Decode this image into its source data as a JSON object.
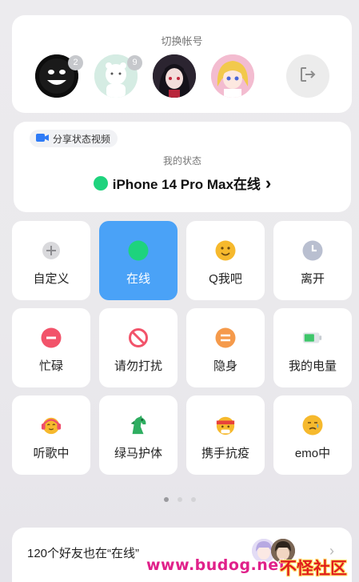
{
  "account_switch": {
    "title": "切换帐号",
    "accounts": [
      {
        "badge": "2"
      },
      {
        "badge": "9"
      },
      {
        "badge": ""
      },
      {
        "badge": ""
      }
    ]
  },
  "status_card": {
    "share_label": "分享状态视频",
    "my_status_label": "我的状态",
    "current_status": "iPhone 14 Pro Max在线",
    "chevron": "›"
  },
  "status_options": [
    {
      "label": "自定义",
      "icon": "plus-icon"
    },
    {
      "label": "在线",
      "icon": "online-dot-icon",
      "selected": true
    },
    {
      "label": "Q我吧",
      "icon": "smile-icon"
    },
    {
      "label": "离开",
      "icon": "clock-icon"
    },
    {
      "label": "忙碌",
      "icon": "minus-icon"
    },
    {
      "label": "请勿打扰",
      "icon": "no-entry-icon"
    },
    {
      "label": "隐身",
      "icon": "equals-icon"
    },
    {
      "label": "我的电量",
      "icon": "battery-icon"
    },
    {
      "label": "听歌中",
      "icon": "headphones-face-icon"
    },
    {
      "label": "绿马护体",
      "icon": "green-horse-icon"
    },
    {
      "label": "携手抗疫",
      "icon": "headband-face-icon"
    },
    {
      "label": "emo中",
      "icon": "sad-face-icon"
    }
  ],
  "pager": {
    "pages": 3,
    "current": 1
  },
  "friends_bar": {
    "text": "120个好友也在“在线”",
    "chevron": "›"
  },
  "watermark": {
    "url": "www.budog.net",
    "site": "不怪社区"
  },
  "colors": {
    "selected_tile": "#4aa2f7",
    "online_green": "#1ed37d",
    "share_icon": "#2f7bf6"
  }
}
